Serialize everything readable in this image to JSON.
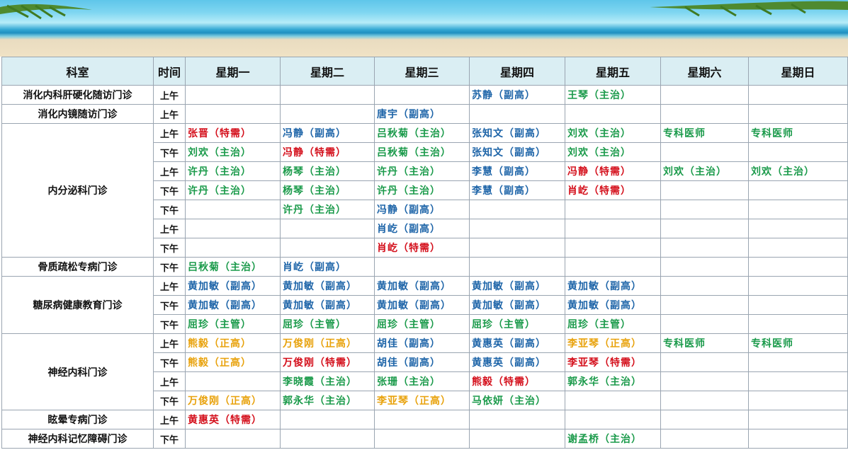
{
  "colors": {
    "green": "#1a9a4a",
    "blue": "#1d64a8",
    "red": "#d40f1b",
    "orange": "#e8a20c",
    "header_bg": "#daeef3"
  },
  "headers": [
    "科室",
    "时间",
    "星期一",
    "星期二",
    "星期三",
    "星期四",
    "星期五",
    "星期六",
    "星期日"
  ],
  "departments": [
    {
      "name": "消化内科肝硬化随访门诊",
      "rows": [
        {
          "time": "上午",
          "cells": [
            null,
            null,
            null,
            {
              "t": "苏静（副高）",
              "k": "blue"
            },
            {
              "t": "王琴（主治）",
              "k": "green"
            },
            null,
            null
          ]
        }
      ]
    },
    {
      "name": "消化内镜随访门诊",
      "rows": [
        {
          "time": "上午",
          "cells": [
            null,
            null,
            {
              "t": "唐宇（副高）",
              "k": "blue"
            },
            null,
            null,
            null,
            null
          ]
        }
      ]
    },
    {
      "name": "内分泌科门诊",
      "rows": [
        {
          "time": "上午",
          "cells": [
            {
              "t": "张晋（特需）",
              "k": "red"
            },
            {
              "t": "冯静（副高）",
              "k": "blue"
            },
            {
              "t": "吕秋菊（主治）",
              "k": "green"
            },
            {
              "t": "张知文（副高）",
              "k": "blue"
            },
            {
              "t": "刘欢（主治）",
              "k": "green"
            },
            {
              "t": "专科医师",
              "k": "green"
            },
            {
              "t": "专科医师",
              "k": "green"
            }
          ]
        },
        {
          "time": "下午",
          "cells": [
            {
              "t": "刘欢（主治）",
              "k": "green"
            },
            {
              "t": "冯静（特需）",
              "k": "red"
            },
            {
              "t": "吕秋菊（主治）",
              "k": "green"
            },
            {
              "t": "张知文（副高）",
              "k": "blue"
            },
            {
              "t": "刘欢（主治）",
              "k": "green"
            },
            null,
            null
          ]
        },
        {
          "time": "上午",
          "cells": [
            {
              "t": "许丹（主治）",
              "k": "green"
            },
            {
              "t": "杨琴（主治）",
              "k": "green"
            },
            {
              "t": "许丹（主治）",
              "k": "green"
            },
            {
              "t": "李慧（副高）",
              "k": "blue"
            },
            {
              "t": "冯静（特需）",
              "k": "red"
            },
            {
              "t": "刘欢（主治）",
              "k": "green"
            },
            {
              "t": "刘欢（主治）",
              "k": "green"
            }
          ]
        },
        {
          "time": "下午",
          "cells": [
            {
              "t": "许丹（主治）",
              "k": "green"
            },
            {
              "t": "杨琴（主治）",
              "k": "green"
            },
            {
              "t": "许丹（主治）",
              "k": "green"
            },
            {
              "t": "李慧（副高）",
              "k": "blue"
            },
            {
              "t": "肖屹（特需）",
              "k": "red"
            },
            null,
            null
          ]
        },
        {
          "time": "下午",
          "cells": [
            null,
            {
              "t": "许丹（主治）",
              "k": "green"
            },
            {
              "t": "冯静（副高）",
              "k": "blue"
            },
            null,
            null,
            null,
            null
          ]
        },
        {
          "time": "上午",
          "cells": [
            null,
            null,
            {
              "t": "肖屹（副高）",
              "k": "blue"
            },
            null,
            null,
            null,
            null
          ]
        },
        {
          "time": "下午",
          "cells": [
            null,
            null,
            {
              "t": "肖屹（特需）",
              "k": "red"
            },
            null,
            null,
            null,
            null
          ]
        }
      ]
    },
    {
      "name": "骨质疏松专病门诊",
      "rows": [
        {
          "time": "下午",
          "cells": [
            {
              "t": "吕秋菊（主治）",
              "k": "green"
            },
            {
              "t": "肖屹（副高）",
              "k": "blue"
            },
            null,
            null,
            null,
            null,
            null
          ]
        }
      ]
    },
    {
      "name": "糖尿病健康教育门诊",
      "rows": [
        {
          "time": "上午",
          "cells": [
            {
              "t": "黄加敏（副高）",
              "k": "blue"
            },
            {
              "t": "黄加敏（副高）",
              "k": "blue"
            },
            {
              "t": "黄加敏（副高）",
              "k": "blue"
            },
            {
              "t": "黄加敏（副高）",
              "k": "blue"
            },
            {
              "t": "黄加敏（副高）",
              "k": "blue"
            },
            null,
            null
          ]
        },
        {
          "time": "下午",
          "cells": [
            {
              "t": "黄加敏（副高）",
              "k": "blue"
            },
            {
              "t": "黄加敏（副高）",
              "k": "blue"
            },
            {
              "t": "黄加敏（副高）",
              "k": "blue"
            },
            {
              "t": "黄加敏（副高）",
              "k": "blue"
            },
            {
              "t": "黄加敏（副高）",
              "k": "blue"
            },
            null,
            null
          ]
        },
        {
          "time": "下午",
          "cells": [
            {
              "t": "屈珍（主管）",
              "k": "green"
            },
            {
              "t": "屈珍（主管）",
              "k": "green"
            },
            {
              "t": "屈珍（主管）",
              "k": "green"
            },
            {
              "t": "屈珍（主管）",
              "k": "green"
            },
            {
              "t": "屈珍（主管）",
              "k": "green"
            },
            null,
            null
          ]
        }
      ]
    },
    {
      "name": "神经内科门诊",
      "rows": [
        {
          "time": "上午",
          "cells": [
            {
              "t": "熊毅（正高）",
              "k": "orange"
            },
            {
              "t": "万俊刚（正高）",
              "k": "orange"
            },
            {
              "t": "胡佳（副高）",
              "k": "blue"
            },
            {
              "t": "黄惠英（副高）",
              "k": "blue"
            },
            {
              "t": "李亚琴（正高）",
              "k": "orange"
            },
            {
              "t": "专科医师",
              "k": "green"
            },
            {
              "t": "专科医师",
              "k": "green"
            }
          ]
        },
        {
          "time": "下午",
          "cells": [
            {
              "t": "熊毅（正高）",
              "k": "orange"
            },
            {
              "t": "万俊刚（特需）",
              "k": "red"
            },
            {
              "t": "胡佳（副高）",
              "k": "blue"
            },
            {
              "t": "黄惠英（副高）",
              "k": "blue"
            },
            {
              "t": "李亚琴（特需）",
              "k": "red"
            },
            null,
            null
          ]
        },
        {
          "time": "上午",
          "cells": [
            null,
            {
              "t": "李晓霞（主治）",
              "k": "green"
            },
            {
              "t": "张珊（主治）",
              "k": "green"
            },
            {
              "t": "熊毅（特需）",
              "k": "red"
            },
            {
              "t": "郭永华（主治）",
              "k": "green"
            },
            null,
            null
          ]
        },
        {
          "time": "下午",
          "cells": [
            {
              "t": "万俊刚（正高）",
              "k": "orange"
            },
            {
              "t": "郭永华（主治）",
              "k": "green"
            },
            {
              "t": "李亚琴（正高）",
              "k": "orange"
            },
            {
              "t": "马依妍（主治）",
              "k": "green"
            },
            null,
            null,
            null
          ]
        }
      ]
    },
    {
      "name": "眩晕专病门诊",
      "rows": [
        {
          "time": "上午",
          "cells": [
            {
              "t": "黄惠英（特需）",
              "k": "red"
            },
            null,
            null,
            null,
            null,
            null,
            null
          ]
        }
      ]
    },
    {
      "name": "神经内科记忆障碍门诊",
      "rows": [
        {
          "time": "下午",
          "cells": [
            null,
            null,
            null,
            null,
            {
              "t": "谢孟桥（主治）",
              "k": "green"
            },
            null,
            null
          ]
        }
      ]
    }
  ]
}
